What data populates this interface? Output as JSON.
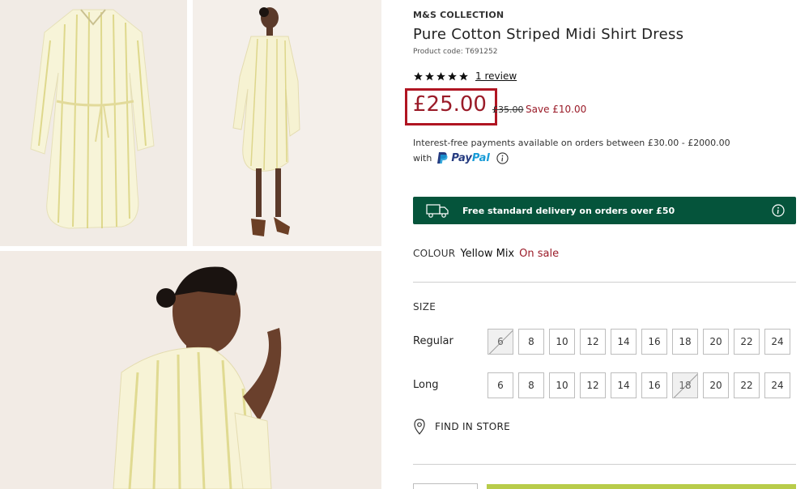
{
  "product": {
    "brand": "M&S COLLECTION",
    "title": "Pure Cotton Striped Midi Shirt Dress",
    "code": "Product code: T691252",
    "rating": 5,
    "review_link": "1 review",
    "price": "£25.00",
    "was_price": "£35.00",
    "save": "Save £10.00"
  },
  "finance": {
    "line1": "Interest-free payments available on orders between £30.00 - £2000.00",
    "with": "with",
    "paypal_part1": "Pay",
    "paypal_part2": "Pal"
  },
  "delivery": {
    "text": "Free standard delivery on orders over £50"
  },
  "colour": {
    "label": "COLOUR",
    "value": "Yellow Mix",
    "status": "On sale"
  },
  "size": {
    "label": "SIZE",
    "regular_label": "Regular",
    "long_label": "Long",
    "regular": [
      {
        "v": "6",
        "unavailable": true
      },
      {
        "v": "8",
        "unavailable": false
      },
      {
        "v": "10",
        "unavailable": false
      },
      {
        "v": "12",
        "unavailable": false
      },
      {
        "v": "14",
        "unavailable": false
      },
      {
        "v": "16",
        "unavailable": false
      },
      {
        "v": "18",
        "unavailable": false
      },
      {
        "v": "20",
        "unavailable": false
      },
      {
        "v": "22",
        "unavailable": false
      },
      {
        "v": "24",
        "unavailable": false
      }
    ],
    "long": [
      {
        "v": "6",
        "unavailable": false
      },
      {
        "v": "8",
        "unavailable": false
      },
      {
        "v": "10",
        "unavailable": false
      },
      {
        "v": "12",
        "unavailable": false
      },
      {
        "v": "14",
        "unavailable": false
      },
      {
        "v": "16",
        "unavailable": false
      },
      {
        "v": "18",
        "unavailable": true
      },
      {
        "v": "20",
        "unavailable": false
      },
      {
        "v": "22",
        "unavailable": false
      },
      {
        "v": "24",
        "unavailable": false
      }
    ]
  },
  "find_store": "FIND IN STORE",
  "colors": {
    "sale_red": "#9a1b28",
    "highlight_border": "#b01522",
    "delivery_green": "#05543b",
    "add_button": "#b8cc4a"
  }
}
